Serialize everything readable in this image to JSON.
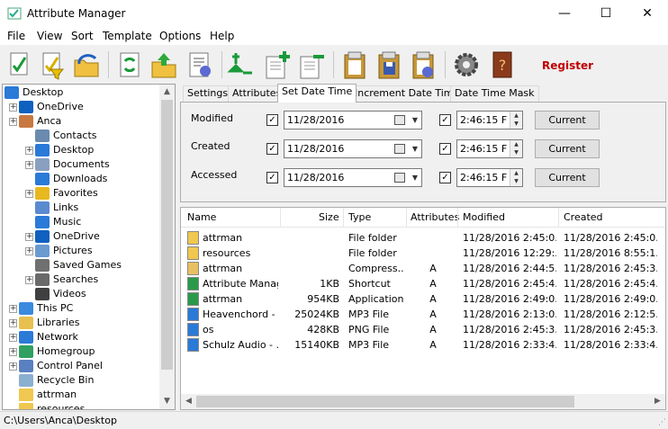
{
  "window": {
    "title": "Attribute Manager",
    "minimize": "—",
    "maximize": "☐",
    "close": "✕"
  },
  "menu": [
    "File",
    "View",
    "Sort",
    "Template",
    "Options",
    "Help"
  ],
  "toolbar": {
    "register_label": "Register",
    "register_color": "#c00000"
  },
  "tree": {
    "items": [
      {
        "label": "Desktop",
        "icon": "desktop-icon"
      },
      {
        "label": "OneDrive",
        "icon": "onedrive-icon"
      },
      {
        "label": "Anca",
        "icon": "user-icon"
      },
      {
        "label": "Contacts",
        "icon": "contacts-icon"
      },
      {
        "label": "Desktop",
        "icon": "desktop-icon"
      },
      {
        "label": "Documents",
        "icon": "documents-icon"
      },
      {
        "label": "Downloads",
        "icon": "downloads-icon"
      },
      {
        "label": "Favorites",
        "icon": "star-icon"
      },
      {
        "label": "Links",
        "icon": "links-icon"
      },
      {
        "label": "Music",
        "icon": "music-icon"
      },
      {
        "label": "OneDrive",
        "icon": "onedrive-icon"
      },
      {
        "label": "Pictures",
        "icon": "pictures-icon"
      },
      {
        "label": "Saved Games",
        "icon": "games-icon"
      },
      {
        "label": "Searches",
        "icon": "search-icon"
      },
      {
        "label": "Videos",
        "icon": "videos-icon"
      },
      {
        "label": "This PC",
        "icon": "computer-icon"
      },
      {
        "label": "Libraries",
        "icon": "libraries-icon"
      },
      {
        "label": "Network",
        "icon": "network-icon"
      },
      {
        "label": "Homegroup",
        "icon": "homegroup-icon"
      },
      {
        "label": "Control Panel",
        "icon": "control-panel-icon"
      },
      {
        "label": "Recycle Bin",
        "icon": "recycle-bin-icon"
      },
      {
        "label": "attrman",
        "icon": "folder-icon"
      },
      {
        "label": "resources",
        "icon": "folder-icon"
      }
    ]
  },
  "tabs": [
    "Settings",
    "Attributes",
    "Set Date Time",
    "Increment Date Time",
    "Date Time Mask"
  ],
  "dates": {
    "modified": {
      "label": "Modified",
      "date": "11/28/2016",
      "time": "2:46:15 F",
      "button": "Current"
    },
    "created": {
      "label": "Created",
      "date": "11/28/2016",
      "time": "2:46:15 F",
      "button": "Current"
    },
    "accessed": {
      "label": "Accessed",
      "date": "11/28/2016",
      "time": "2:46:15 F",
      "button": "Current"
    },
    "check_mark": "✓"
  },
  "list": {
    "columns": [
      "Name",
      "Size",
      "Type",
      "Attributes",
      "Modified",
      "Created"
    ],
    "rows": [
      {
        "name": "attrman",
        "size": "",
        "type": "File folder",
        "attr": "",
        "modified": "11/28/2016 2:45:0...",
        "created": "11/28/2016 2:45:0...",
        "icon": "folder-icon"
      },
      {
        "name": "resources",
        "size": "",
        "type": "File folder",
        "attr": "",
        "modified": "11/28/2016 12:29:...",
        "created": "11/28/2016 8:55:1...",
        "icon": "folder-icon"
      },
      {
        "name": "attrman",
        "size": "",
        "type": "Compress...",
        "attr": "A",
        "modified": "11/28/2016 2:44:5...",
        "created": "11/28/2016 2:45:3...",
        "icon": "zip-icon"
      },
      {
        "name": "Attribute Manager",
        "size": "1KB",
        "type": "Shortcut",
        "attr": "A",
        "modified": "11/28/2016 2:45:4...",
        "created": "11/28/2016 2:45:4...",
        "icon": "shortcut-icon"
      },
      {
        "name": "attrman",
        "size": "954KB",
        "type": "Application",
        "attr": "A",
        "modified": "11/28/2016 2:49:0...",
        "created": "11/28/2016 2:49:0...",
        "icon": "app-icon"
      },
      {
        "name": "Heavenchord - ...",
        "size": "25024KB",
        "type": "MP3 File",
        "attr": "A",
        "modified": "11/28/2016 2:13:0...",
        "created": "11/28/2016 2:12:5...",
        "icon": "audio-icon"
      },
      {
        "name": "os",
        "size": "428KB",
        "type": "PNG File",
        "attr": "A",
        "modified": "11/28/2016 2:45:3...",
        "created": "11/28/2016 2:45:3...",
        "icon": "image-icon"
      },
      {
        "name": "Schulz Audio - ...",
        "size": "15140KB",
        "type": "MP3 File",
        "attr": "A",
        "modified": "11/28/2016 2:33:4...",
        "created": "11/28/2016 2:33:4...",
        "icon": "audio-icon"
      }
    ]
  },
  "status": {
    "path": "C:\\Users\\Anca\\Desktop"
  }
}
